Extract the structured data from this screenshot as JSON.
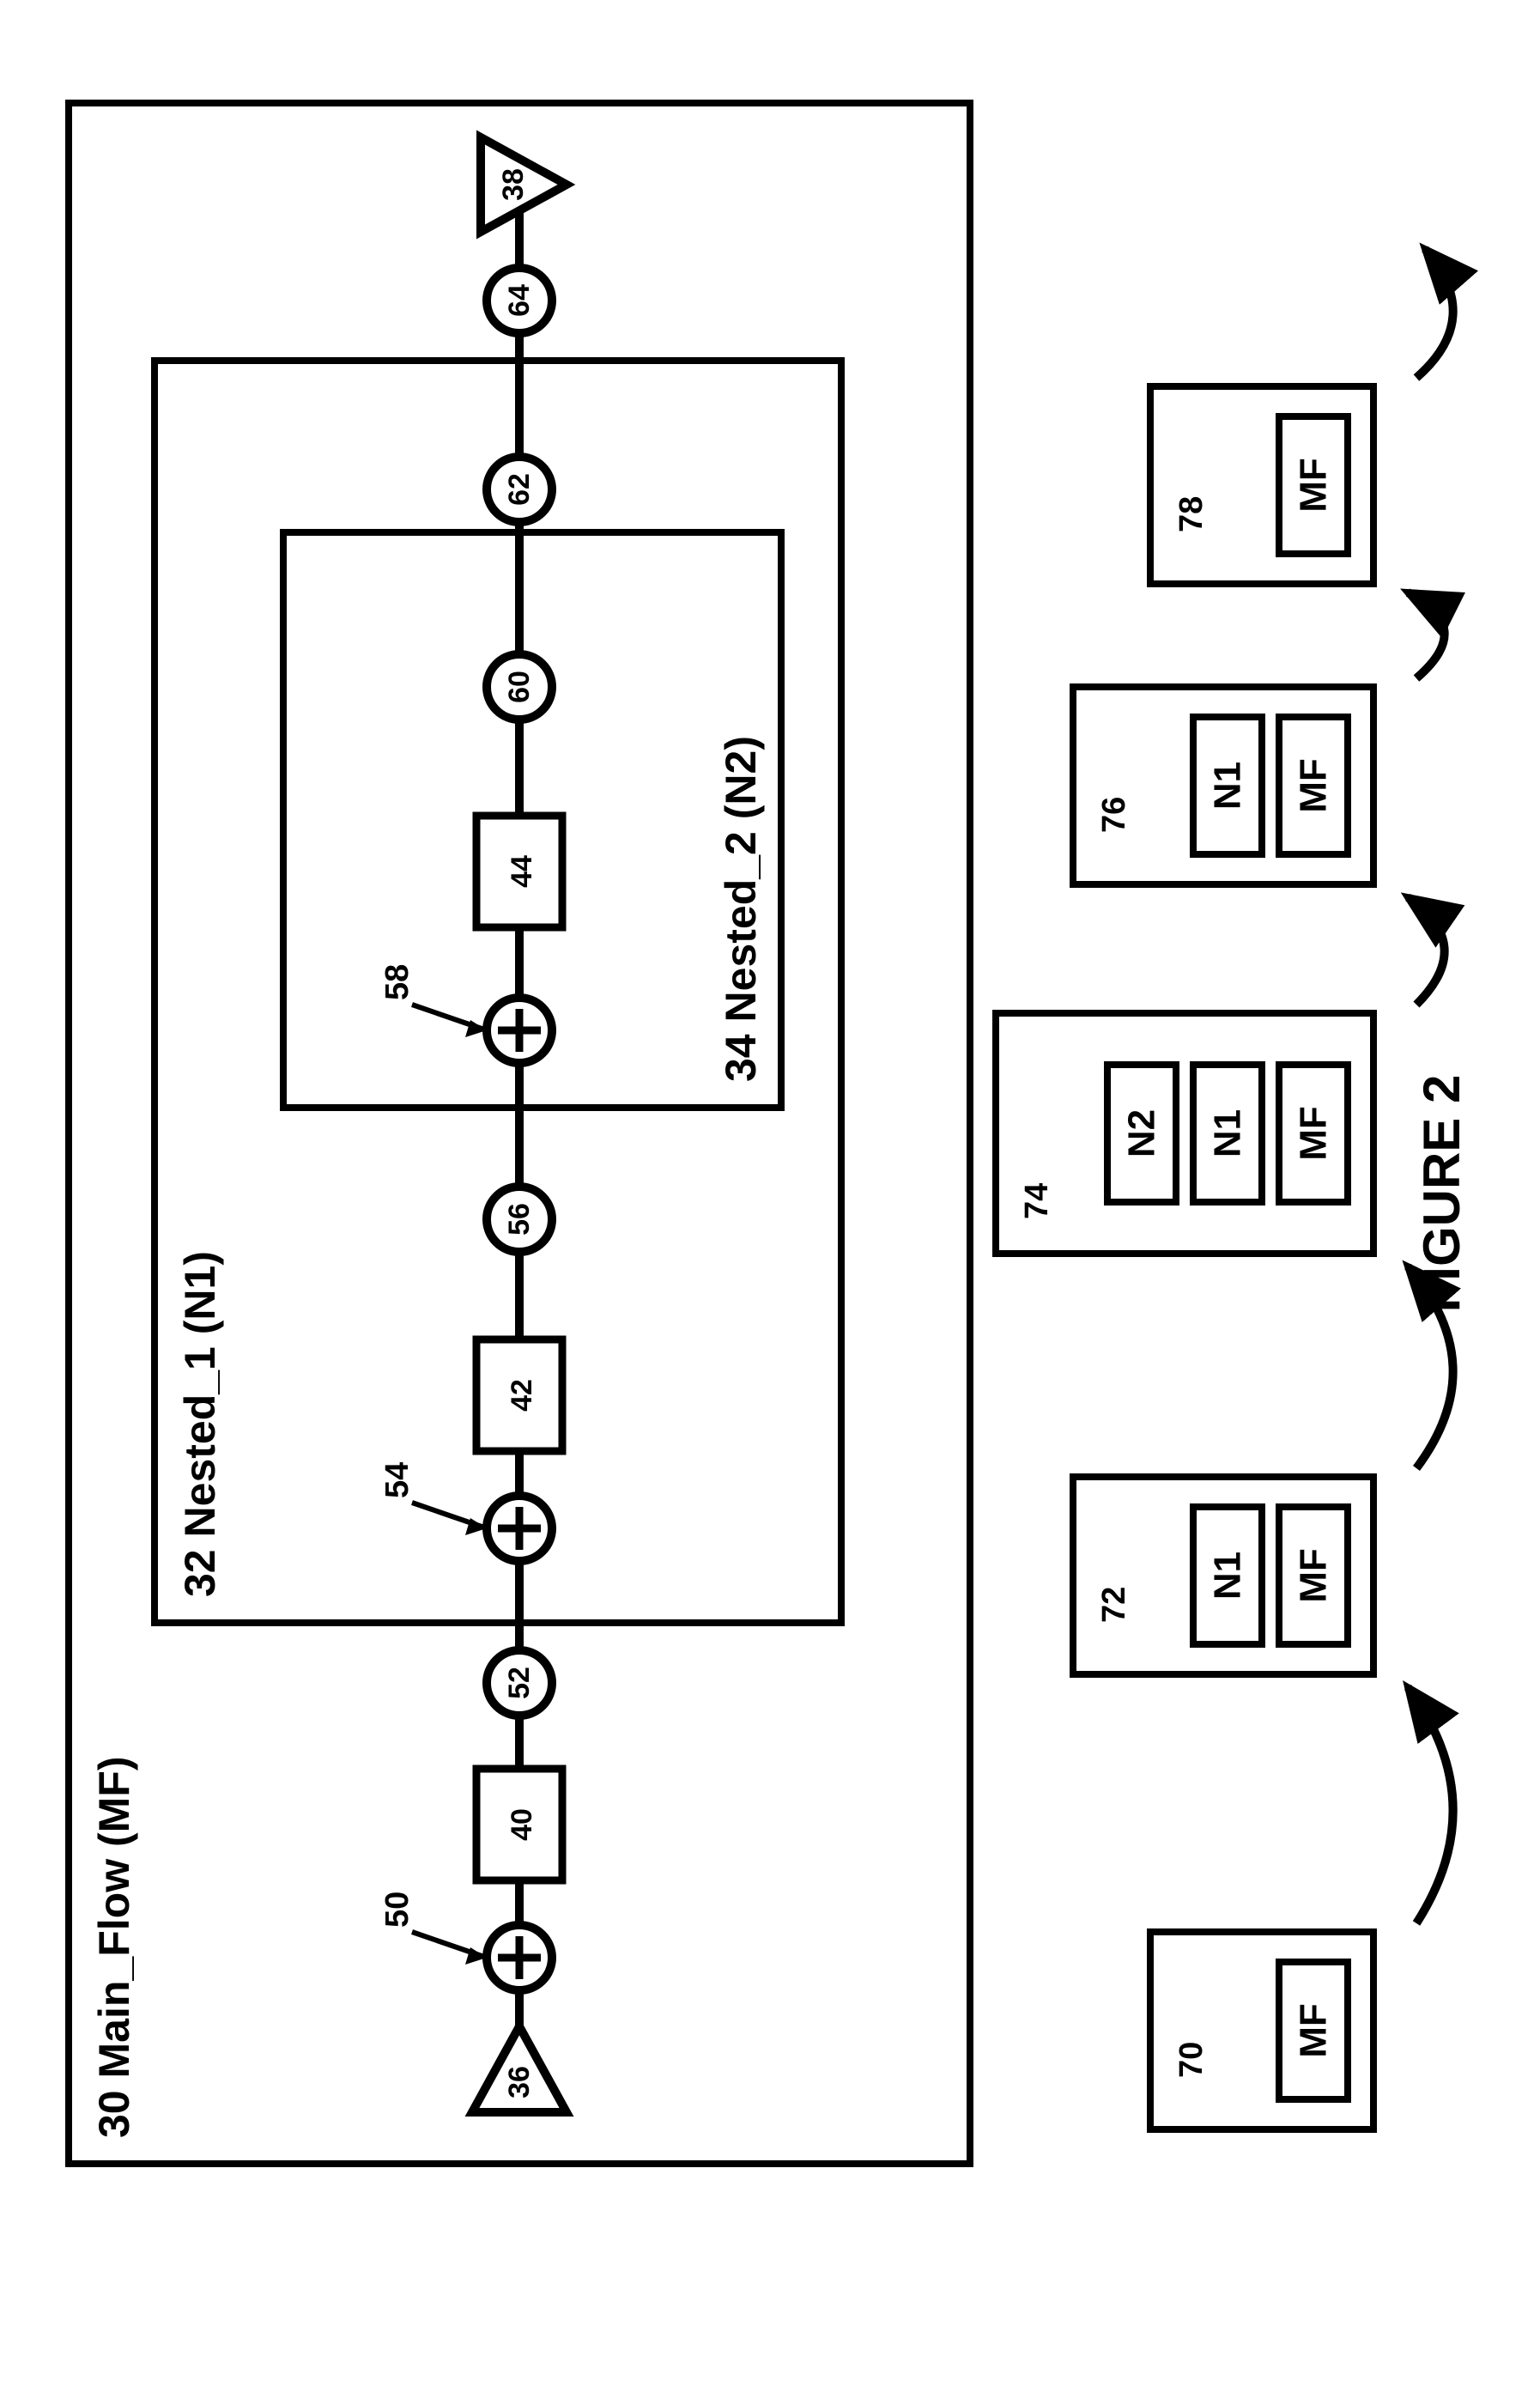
{
  "mainFlow": {
    "ref": "30",
    "label": "Main_Flow (MF)"
  },
  "nested1": {
    "ref": "32",
    "label": "Nested_1 (N1)"
  },
  "nested2": {
    "ref": "34",
    "label": "Nested_2 (N2)"
  },
  "startTriangle": "36",
  "endTriangle": "38",
  "boxes": {
    "b40": "40",
    "b42": "42",
    "b44": "44"
  },
  "plusNodes": {
    "p50": "50",
    "p54": "54",
    "p58": "58"
  },
  "circleNodes": {
    "c52": "52",
    "c56": "56",
    "c60": "60",
    "c62": "62",
    "c64": "64"
  },
  "stacks": {
    "s70": {
      "ref": "70",
      "items": [
        "MF"
      ]
    },
    "s72": {
      "ref": "72",
      "items": [
        "N1",
        "MF"
      ]
    },
    "s74": {
      "ref": "74",
      "items": [
        "N2",
        "N1",
        "MF"
      ]
    },
    "s76": {
      "ref": "76",
      "items": [
        "N1",
        "MF"
      ]
    },
    "s78": {
      "ref": "78",
      "items": [
        "MF"
      ]
    }
  },
  "figureLabel": "FIGURE 2",
  "chart_data": {
    "type": "diagram",
    "description": "Process flow diagram with nested scopes and corresponding call-stack states",
    "scopes": [
      {
        "id": 30,
        "name": "Main_Flow",
        "abbrev": "MF",
        "contains": [
          32
        ]
      },
      {
        "id": 32,
        "name": "Nested_1",
        "abbrev": "N1",
        "contains": [
          34
        ]
      },
      {
        "id": 34,
        "name": "Nested_2",
        "abbrev": "N2",
        "contains": []
      }
    ],
    "flow_sequence": [
      {
        "id": 36,
        "type": "start-triangle",
        "scope": "MF"
      },
      {
        "id": 50,
        "type": "plus-circle",
        "scope": "MF"
      },
      {
        "id": 40,
        "type": "box",
        "scope": "MF"
      },
      {
        "id": 52,
        "type": "circle",
        "scope": "MF"
      },
      {
        "id": 54,
        "type": "plus-circle",
        "scope": "N1"
      },
      {
        "id": 42,
        "type": "box",
        "scope": "N1"
      },
      {
        "id": 56,
        "type": "circle",
        "scope": "N1"
      },
      {
        "id": 58,
        "type": "plus-circle",
        "scope": "N2"
      },
      {
        "id": 44,
        "type": "box",
        "scope": "N2"
      },
      {
        "id": 60,
        "type": "circle",
        "scope": "N2"
      },
      {
        "id": 62,
        "type": "circle",
        "scope": "N1"
      },
      {
        "id": 64,
        "type": "circle",
        "scope": "MF"
      },
      {
        "id": 38,
        "type": "end-triangle",
        "scope": "MF"
      }
    ],
    "stack_states": [
      {
        "id": 70,
        "stack": [
          "MF"
        ]
      },
      {
        "id": 72,
        "stack": [
          "N1",
          "MF"
        ]
      },
      {
        "id": 74,
        "stack": [
          "N2",
          "N1",
          "MF"
        ]
      },
      {
        "id": 76,
        "stack": [
          "N1",
          "MF"
        ]
      },
      {
        "id": 78,
        "stack": [
          "MF"
        ]
      }
    ]
  }
}
